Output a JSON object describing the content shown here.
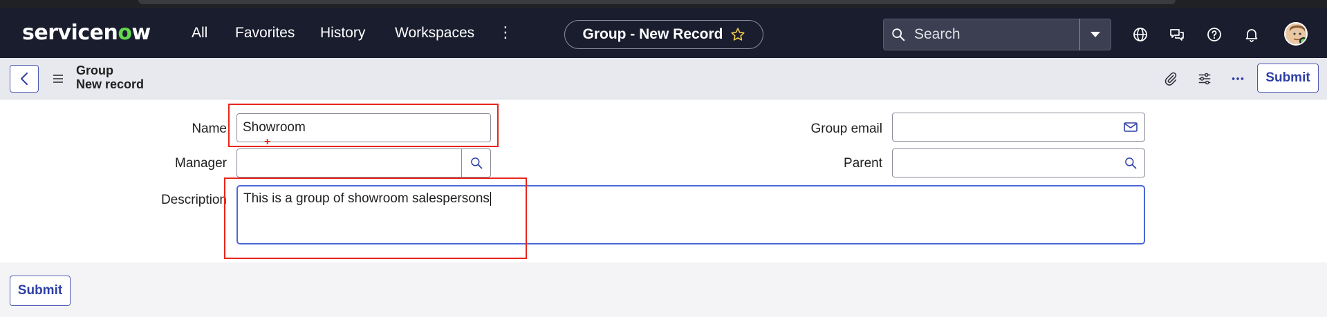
{
  "app": {
    "logo_prefix": "servicen",
    "logo_o": "o",
    "logo_suffix": "w"
  },
  "nav": {
    "links": [
      "All",
      "Favorites",
      "History",
      "Workspaces"
    ],
    "more_icon": "kebab-vertical-icon",
    "record_title": "Group - New Record",
    "favorite_icon": "star-outline-icon"
  },
  "search": {
    "placeholder": "Search",
    "icon": "search-icon",
    "dropdown_icon": "caret-down-icon"
  },
  "header_icons": [
    "globe-icon",
    "chat-icon",
    "help-icon",
    "bell-icon"
  ],
  "form_header": {
    "table": "Group",
    "subtitle": "New record",
    "submit_label": "Submit",
    "toolbar_icons": [
      "paperclip-icon",
      "sliders-icon",
      "more-horizontal-icon"
    ]
  },
  "form": {
    "name_label": "Name",
    "name_value": "Showroom",
    "manager_label": "Manager",
    "manager_value": "",
    "description_label": "Description",
    "description_value": "This is a group of showroom salespersons",
    "group_email_label": "Group email",
    "group_email_value": "",
    "parent_label": "Parent",
    "parent_value": ""
  },
  "footer": {
    "submit_label": "Submit"
  },
  "colors": {
    "navbar_bg": "#1a1d2e",
    "accent": "#2e3fa6",
    "logo_green": "#62d84e",
    "highlight_red": "#e8261c"
  }
}
